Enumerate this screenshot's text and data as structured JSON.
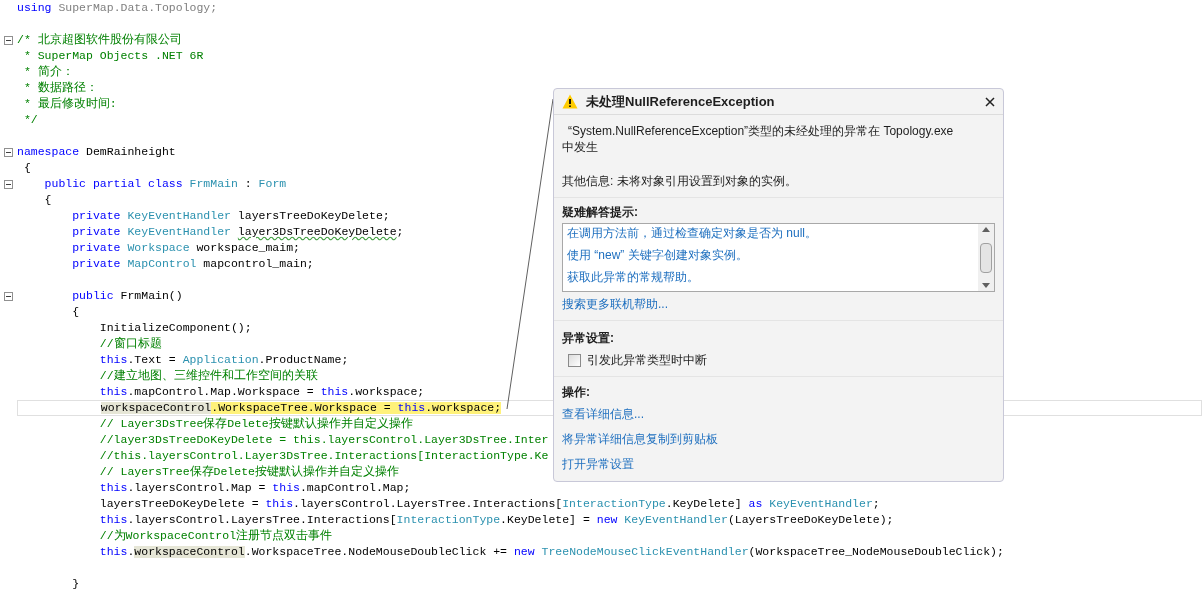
{
  "editor": {
    "lines": [
      {
        "fold": false,
        "current": false,
        "tokens": [
          {
            "kind": "kw",
            "text": "using"
          },
          {
            "kind": "dim",
            "text": " SuperMap.Data.Topology;"
          }
        ]
      },
      {
        "fold": false,
        "current": false
      },
      {
        "fold": true,
        "current": false,
        "tokens": [
          {
            "kind": "comment",
            "text": "/* 北京超图软件股份有限公司"
          }
        ]
      },
      {
        "fold": false,
        "current": false,
        "tokens": [
          {
            "kind": "comment",
            "text": " * SuperMap Objects .NET 6R"
          }
        ]
      },
      {
        "fold": false,
        "current": false,
        "tokens": [
          {
            "kind": "comment",
            "text": " * 简介："
          }
        ]
      },
      {
        "fold": false,
        "current": false,
        "tokens": [
          {
            "kind": "comment",
            "text": " * 数据路径："
          }
        ]
      },
      {
        "fold": false,
        "current": false,
        "tokens": [
          {
            "kind": "comment",
            "text": " * 最后修改时间:"
          }
        ]
      },
      {
        "fold": false,
        "current": false,
        "tokens": [
          {
            "kind": "comment",
            "text": " */"
          }
        ]
      },
      {
        "fold": false,
        "current": false
      },
      {
        "fold": true,
        "current": false,
        "tokens": [
          {
            "kind": "kw",
            "text": "namespace"
          },
          {
            "kind": "plain",
            "text": " DemRainheight"
          }
        ]
      },
      {
        "fold": false,
        "current": false,
        "tokens": [
          {
            "kind": "plain",
            "text": " {"
          }
        ]
      },
      {
        "fold": true,
        "current": false,
        "tokens": [
          {
            "kind": "kw",
            "text": "    public partial class"
          },
          {
            "kind": "type",
            "text": " FrmMain"
          },
          {
            "kind": "plain",
            "text": " : "
          },
          {
            "kind": "type",
            "text": "Form"
          }
        ]
      },
      {
        "fold": false,
        "current": false,
        "tokens": [
          {
            "kind": "plain",
            "text": "    {"
          }
        ]
      },
      {
        "fold": false,
        "current": false,
        "tokens": [
          {
            "kind": "kw",
            "text": "        private"
          },
          {
            "kind": "type",
            "text": " KeyEventHandler"
          },
          {
            "kind": "plain",
            "text": " layersTreeDoKeyDelete;"
          }
        ]
      },
      {
        "fold": false,
        "current": false,
        "tokens": [
          {
            "kind": "kw",
            "text": "        private"
          },
          {
            "kind": "type",
            "text": " KeyEventHandler"
          },
          {
            "kind": "plain",
            "text": " layer3DsTreeDoKeyDelete",
            "squiggle": true
          },
          {
            "kind": "plain",
            "text": ";"
          }
        ]
      },
      {
        "fold": false,
        "current": false,
        "tokens": [
          {
            "kind": "kw",
            "text": "        private"
          },
          {
            "kind": "type",
            "text": " Workspace"
          },
          {
            "kind": "plain",
            "text": " workspace_maim;"
          }
        ]
      },
      {
        "fold": false,
        "current": false,
        "tokens": [
          {
            "kind": "kw",
            "text": "        private"
          },
          {
            "kind": "type",
            "text": " MapControl"
          },
          {
            "kind": "plain",
            "text": " mapcontrol_main;"
          }
        ]
      },
      {
        "fold": false,
        "current": false
      },
      {
        "fold": true,
        "current": false,
        "tokens": [
          {
            "kind": "kw",
            "text": "        public"
          },
          {
            "kind": "plain",
            "text": " FrmMain()"
          }
        ]
      },
      {
        "fold": false,
        "current": false,
        "tokens": [
          {
            "kind": "plain",
            "text": "        {"
          }
        ]
      },
      {
        "fold": false,
        "current": false,
        "tokens": [
          {
            "kind": "plain",
            "text": "            InitializeComponent();"
          }
        ]
      },
      {
        "fold": false,
        "current": false,
        "tokens": [
          {
            "kind": "comment",
            "text": "            //窗口标题"
          }
        ]
      },
      {
        "fold": false,
        "current": false,
        "tokens": [
          {
            "kind": "kw",
            "text": "            this"
          },
          {
            "kind": "plain",
            "text": ".Text = "
          },
          {
            "kind": "type",
            "text": "Application"
          },
          {
            "kind": "plain",
            "text": ".ProductName;"
          }
        ]
      },
      {
        "fold": false,
        "current": false,
        "tokens": [
          {
            "kind": "comment",
            "text": "            //建立地图、三维控件和工作空间的关联"
          }
        ]
      },
      {
        "fold": false,
        "current": false,
        "tokens": [
          {
            "kind": "kw",
            "text": "            this"
          },
          {
            "kind": "plain",
            "text": ".mapControl.Map.Workspace = "
          },
          {
            "kind": "kw",
            "text": "this"
          },
          {
            "kind": "plain",
            "text": ".workspace;"
          }
        ]
      },
      {
        "fold": false,
        "current": true,
        "tokens": [
          {
            "kind": "plain",
            "text": "            workspaceControl",
            "reference_highlight": true
          },
          {
            "kind": "plain",
            "text": ".WorkspaceTree.Workspace = ",
            "statement_highlight": true
          },
          {
            "kind": "kw",
            "text": "this",
            "statement_highlight": true
          },
          {
            "kind": "plain",
            "text": ".workspace;",
            "statement_highlight": true
          }
        ]
      },
      {
        "fold": false,
        "current": false,
        "tokens": [
          {
            "kind": "comment",
            "text": "            // Layer3DsTree保存Delete按键默认操作并自定义操作"
          }
        ]
      },
      {
        "fold": false,
        "current": false,
        "tokens": [
          {
            "kind": "comment",
            "text": "            //layer3DsTreeDoKeyDelete = this.layersControl.Layer3DsTree.Inter"
          }
        ]
      },
      {
        "fold": false,
        "current": false,
        "tokens": [
          {
            "kind": "comment",
            "text": "            //this.layersControl.Layer3DsTree.Interactions[InteractionType.Ke"
          }
        ]
      },
      {
        "fold": false,
        "current": false,
        "tokens": [
          {
            "kind": "comment",
            "text": "            // LayersTree保存Delete按键默认操作并自定义操作"
          }
        ]
      },
      {
        "fold": false,
        "current": false,
        "tokens": [
          {
            "kind": "kw",
            "text": "            this"
          },
          {
            "kind": "plain",
            "text": ".layersControl.Map = "
          },
          {
            "kind": "kw",
            "text": "this"
          },
          {
            "kind": "plain",
            "text": ".mapControl.Map;"
          }
        ]
      },
      {
        "fold": false,
        "current": false,
        "tokens": [
          {
            "kind": "plain",
            "text": "            layersTreeDoKeyDelete = "
          },
          {
            "kind": "kw",
            "text": "this"
          },
          {
            "kind": "plain",
            "text": ".layersControl.LayersTree.Interactions["
          },
          {
            "kind": "type",
            "text": "InteractionType"
          },
          {
            "kind": "plain",
            "text": ".KeyDelete] "
          },
          {
            "kind": "kw",
            "text": "as"
          },
          {
            "kind": "type",
            "text": " KeyEventHandler"
          },
          {
            "kind": "plain",
            "text": ";"
          }
        ]
      },
      {
        "fold": false,
        "current": false,
        "tokens": [
          {
            "kind": "kw",
            "text": "            this"
          },
          {
            "kind": "plain",
            "text": ".layersControl.LayersTree.Interactions["
          },
          {
            "kind": "type",
            "text": "InteractionType"
          },
          {
            "kind": "plain",
            "text": ".KeyDelete] = "
          },
          {
            "kind": "kw",
            "text": "new"
          },
          {
            "kind": "type",
            "text": " KeyEventHandler"
          },
          {
            "kind": "plain",
            "text": "(LayersTreeDoKeyDelete);"
          }
        ]
      },
      {
        "fold": false,
        "current": false,
        "tokens": [
          {
            "kind": "comment",
            "text": "            //为WorkspaceControl注册节点双击事件"
          }
        ]
      },
      {
        "fold": false,
        "current": false,
        "tokens": [
          {
            "kind": "kw",
            "text": "            this"
          },
          {
            "kind": "plain",
            "text": "."
          },
          {
            "kind": "plain",
            "text": "workspaceControl",
            "reference_highlight": true
          },
          {
            "kind": "plain",
            "text": ".WorkspaceTree.NodeMouseDoubleClick += "
          },
          {
            "kind": "kw",
            "text": "new"
          },
          {
            "kind": "type",
            "text": " TreeNodeMouseClickEventHandler"
          },
          {
            "kind": "plain",
            "text": "(WorkspaceTree_NodeMouseDoubleClick);"
          }
        ]
      },
      {
        "fold": false,
        "current": false
      },
      {
        "fold": false,
        "current": false,
        "tokens": [
          {
            "kind": "plain",
            "text": "        }"
          }
        ]
      }
    ]
  },
  "exception_dialog": {
    "title": "未处理NullReferenceException",
    "message": "“System.NullReferenceException”类型的未经处理的异常在 Topology.exe 中发生",
    "additional_info": "其他信息: 未将对象引用设置到对象的实例。",
    "tips_heading": "疑难解答提示:",
    "tips": [
      "在调用方法前，通过检查确定对象是否为 null。",
      "使用 “new” 关键字创建对象实例。",
      "获取此异常的常规帮助。"
    ],
    "search_link": "搜索更多联机帮助...",
    "settings_heading": "异常设置:",
    "break_checkbox": {
      "label": "引发此异常类型时中断",
      "checked": false
    },
    "actions_heading": "操作:",
    "actions": [
      "查看详细信息...",
      "将异常详细信息复制到剪贴板",
      "打开异常设置"
    ]
  }
}
